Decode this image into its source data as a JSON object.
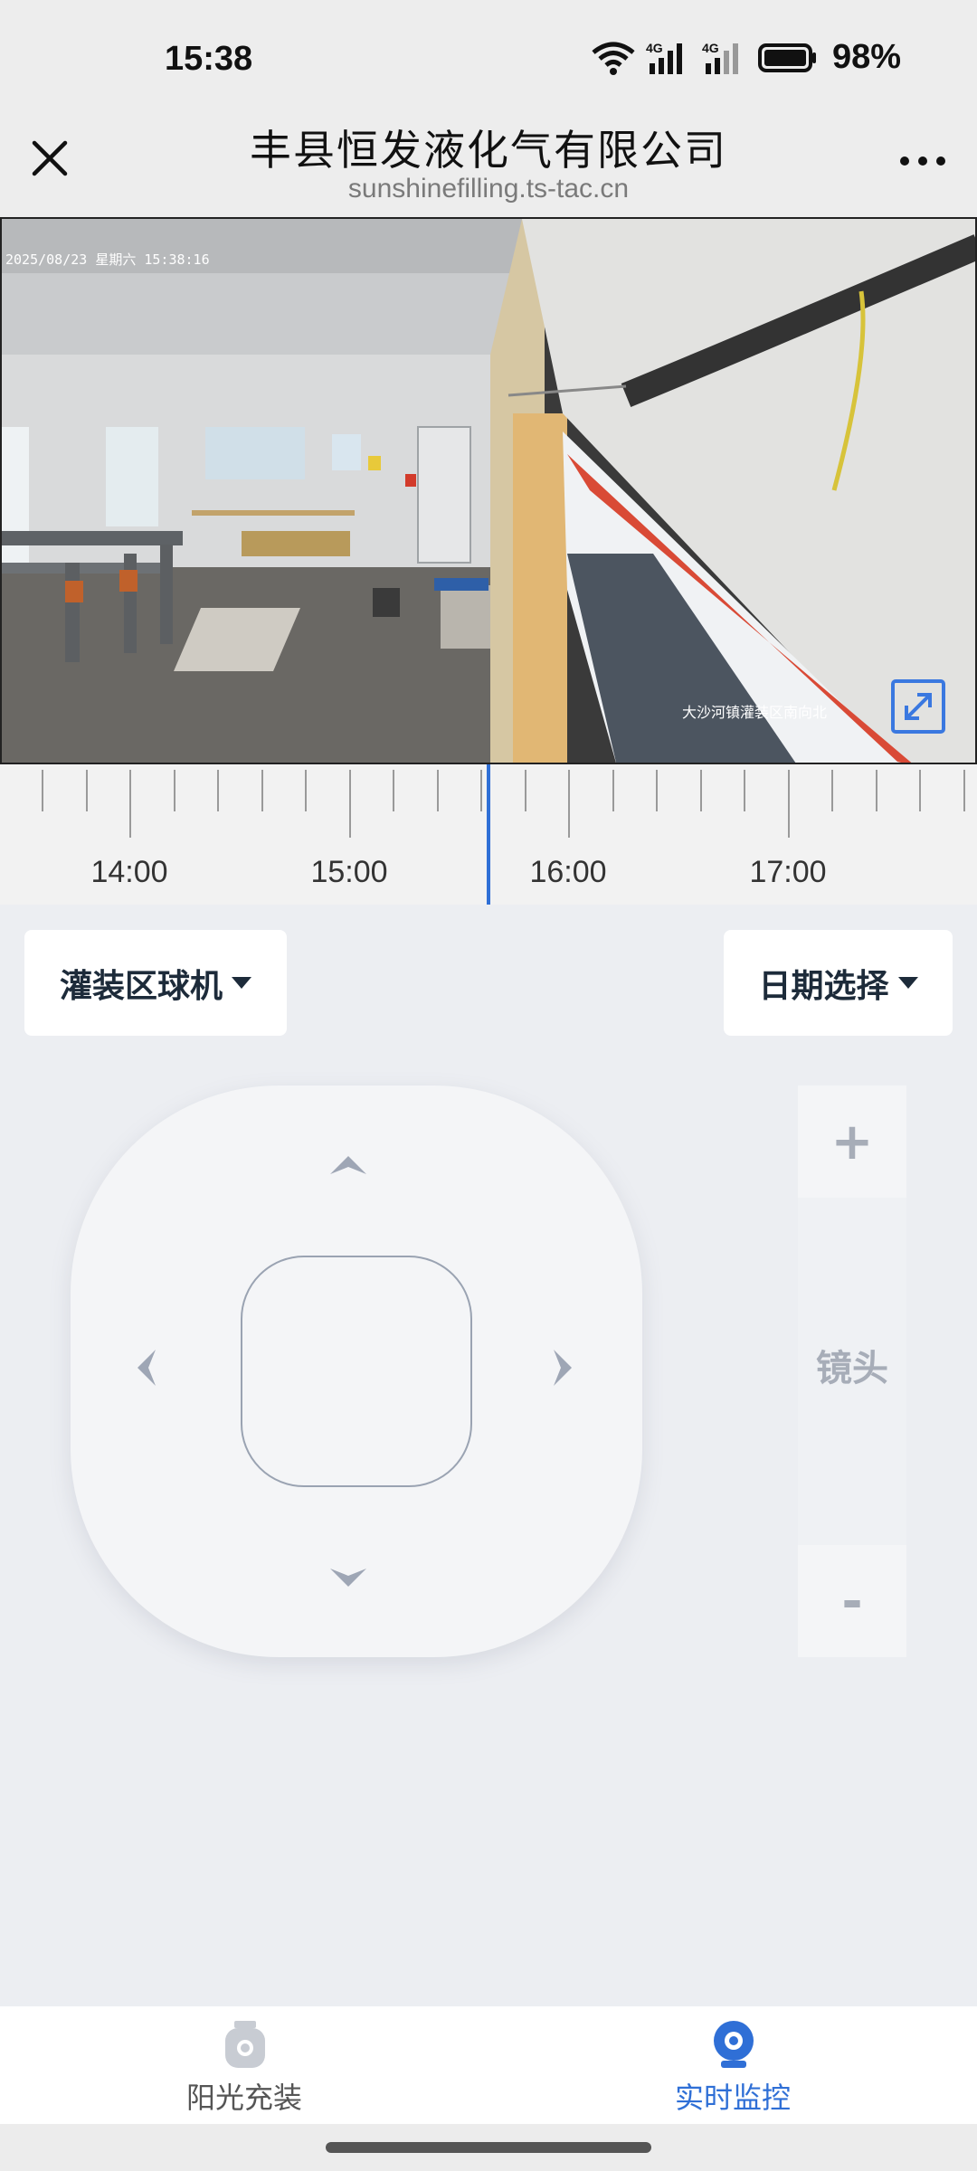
{
  "status_bar": {
    "time": "15:38",
    "battery": "98%",
    "net1": "4G",
    "net2": "4G"
  },
  "nav": {
    "title": "丰县恒发液化气有限公司",
    "url": "sunshinefilling.ts-tac.cn"
  },
  "video": {
    "osd_datetime": "2025/08/23 星期六 15:38:16",
    "osd_location": "大沙河镇灌装区南向北"
  },
  "timeline": {
    "labels": [
      "14:00",
      "15:00",
      "16:00",
      "17:00"
    ],
    "current": "15:38"
  },
  "controls": {
    "camera_select": "灌装区球机",
    "date_select": "日期选择",
    "zoom_in": "+",
    "zoom_label": "镜头",
    "zoom_out": "-"
  },
  "tabs": [
    {
      "label": "阳光充装",
      "active": false,
      "icon": "gas-cylinder-icon"
    },
    {
      "label": "实时监控",
      "active": true,
      "icon": "camera-icon"
    }
  ],
  "colors": {
    "accent": "#2f6fd6",
    "inactive": "#555555",
    "control_gray": "#a7adb8"
  }
}
